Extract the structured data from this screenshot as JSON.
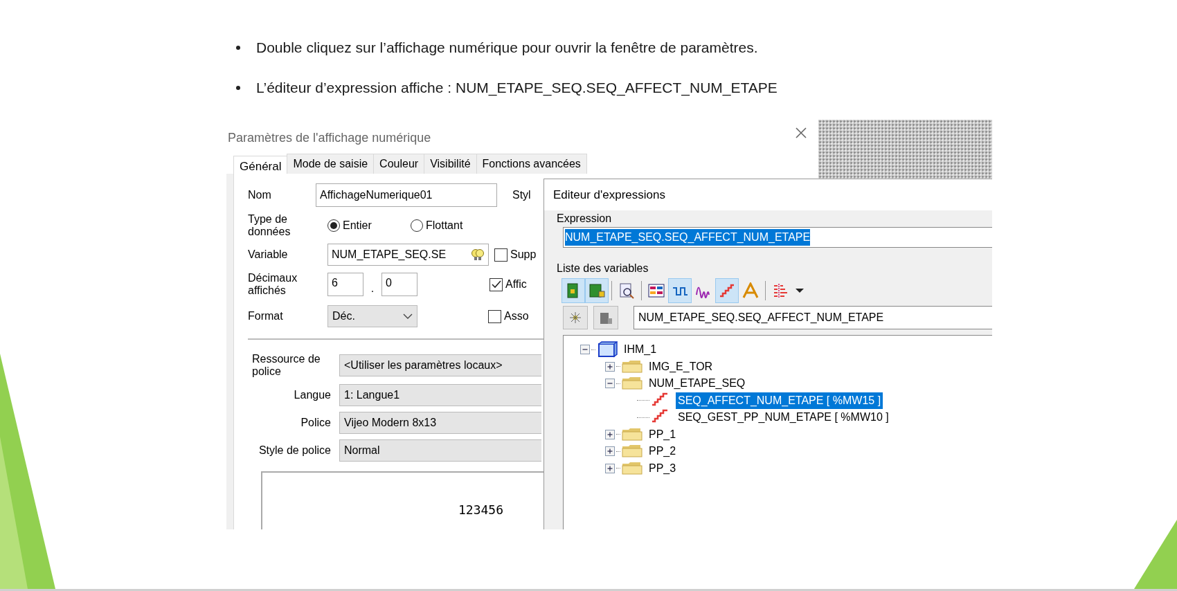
{
  "slide": {
    "bullets": [
      "Double cliquez sur l’affichage numérique pour ouvrir la fenêtre de paramètres.",
      "L’éditeur d’expression affiche : NUM_ETAPE_SEQ.SEQ_AFFECT_NUM_ETAPE"
    ]
  },
  "parameters_dialog": {
    "title": "Paramètres de l'affichage numérique",
    "tabs": [
      {
        "label": "Général",
        "selected": true
      },
      {
        "label": "Mode de saisie",
        "selected": false
      },
      {
        "label": "Couleur",
        "selected": false
      },
      {
        "label": "Visibilité",
        "selected": false
      },
      {
        "label": "Fonctions avancées",
        "selected": false
      }
    ],
    "nom": {
      "label": "Nom",
      "value": "AffichageNumerique01"
    },
    "style_label": "Styl",
    "data_type": {
      "label": "Type de données",
      "options": [
        {
          "label": "Entier",
          "selected": true
        },
        {
          "label": "Flottant",
          "selected": false
        }
      ]
    },
    "variable": {
      "label": "Variable",
      "value": "NUM_ETAPE_SEQ.SE"
    },
    "decimals": {
      "label": "Décimaux affichés",
      "integer": "6",
      "separator": ".",
      "fraction": "0"
    },
    "format": {
      "label": "Format",
      "value": "Déc."
    },
    "options": [
      {
        "label": "Supp",
        "checked": false
      },
      {
        "label": "Affic",
        "checked": true
      },
      {
        "label": "Asso",
        "checked": false
      }
    ],
    "font_fields": [
      {
        "label": "Ressource de police",
        "value": "<Utiliser les paramètres locaux>"
      },
      {
        "label": "Langue",
        "value": "1: Langue1"
      },
      {
        "label": "Police",
        "value": "Vijeo Modern 8x13"
      },
      {
        "label": "Style de police",
        "value": "Normal"
      }
    ],
    "preview": "123456"
  },
  "expression_editor": {
    "title": "Editeur d'expressions",
    "expression_label": "Expression",
    "expression": "NUM_ETAPE_SEQ.SEQ_AFFECT_NUM_ETAPE",
    "variables_label": "Liste des variables",
    "toolbar_groups": [
      [
        {
          "kind": "page",
          "pressed": true
        },
        {
          "kind": "page-lock",
          "pressed": true
        }
      ],
      [
        {
          "kind": "search",
          "pressed": false
        }
      ],
      [
        {
          "kind": "table",
          "pressed": false
        },
        {
          "kind": "square-wave",
          "pressed": true
        },
        {
          "kind": "wave",
          "pressed": false
        },
        {
          "kind": "staircase",
          "pressed": true
        },
        {
          "kind": "text",
          "pressed": false
        }
      ],
      [
        {
          "kind": "tree-filter",
          "pressed": false
        },
        {
          "kind": "dropdown",
          "pressed": false
        }
      ]
    ],
    "filter": "NUM_ETAPE_SEQ.SEQ_AFFECT_NUM_ETAPE",
    "tree": [
      {
        "label": "IHM_1",
        "kind": "station",
        "expanded": true,
        "children": [
          {
            "label": "IMG_E_TOR",
            "kind": "folder",
            "expanded": false
          },
          {
            "label": "NUM_ETAPE_SEQ",
            "kind": "folder",
            "expanded": true,
            "children": [
              {
                "label": "SEQ_AFFECT_NUM_ETAPE [ %MW15 ]",
                "kind": "variable",
                "selected": true
              },
              {
                "label": "SEQ_GEST_PP_NUM_ETAPE [ %MW10 ]",
                "kind": "variable",
                "selected": false
              }
            ]
          },
          {
            "label": "PP_1",
            "kind": "folder",
            "expanded": false
          },
          {
            "label": "PP_2",
            "kind": "folder",
            "expanded": false
          },
          {
            "label": "PP_3",
            "kind": "folder",
            "expanded": false
          }
        ]
      }
    ]
  }
}
